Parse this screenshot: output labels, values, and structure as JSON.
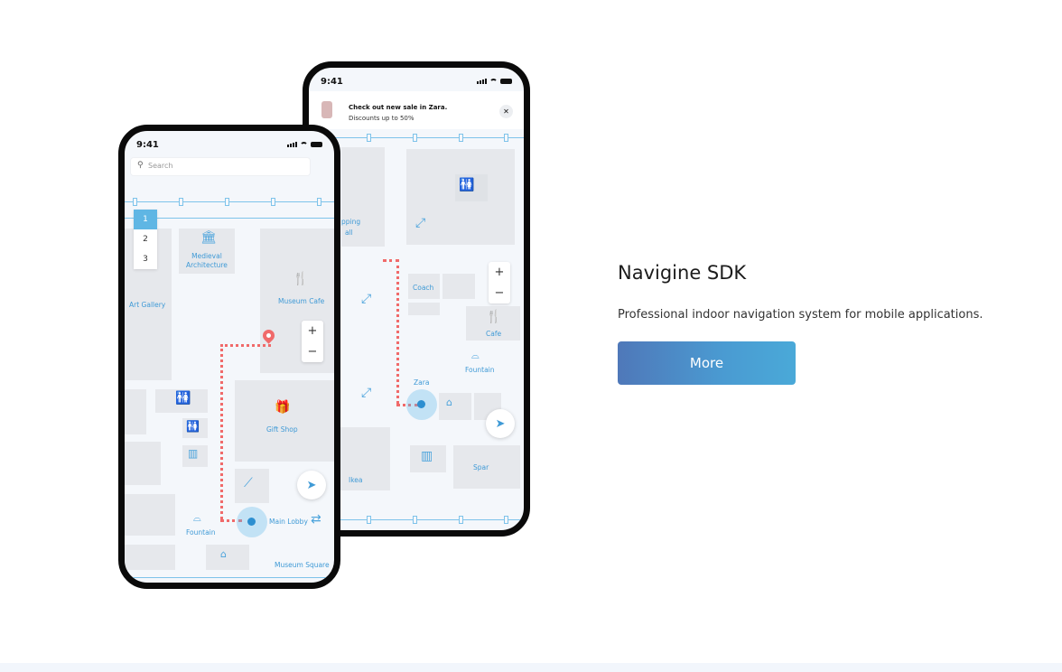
{
  "front_phone": {
    "time": "9:41",
    "search_placeholder": "Search",
    "floors": [
      "1",
      "2",
      "3"
    ],
    "zoom_in": "+",
    "zoom_out": "−",
    "labels": {
      "medieval": "Medieval\nArchitecture",
      "art_gallery": "Art Gallery",
      "museum_cafe": "Museum Cafe",
      "gift_shop": "Gift Shop",
      "fountain": "Fountain",
      "main_lobby": "Main Lobby",
      "museum_square": "Museum Square"
    }
  },
  "back_phone": {
    "time": "9:41",
    "notification": {
      "line1": "Check out new sale in Zara.",
      "line2": "Discounts up to 50%",
      "close": "✕"
    },
    "zoom_in": "+",
    "zoom_out": "−",
    "labels": {
      "shopping_mall_a": "pping",
      "shopping_mall_b": "all",
      "coach": "Coach",
      "cafe": "Cafe",
      "fountain": "Fountain",
      "zara": "Zara",
      "ikea": "Ikea",
      "spar": "Spar"
    }
  },
  "product": {
    "title": "Navigine SDK",
    "description": "Professional indoor navigation system for mobile applications.",
    "button": "More"
  },
  "colors": {
    "accent": "#4a9bd2",
    "route": "#f06a6a",
    "map_line": "#7ec3ea"
  }
}
